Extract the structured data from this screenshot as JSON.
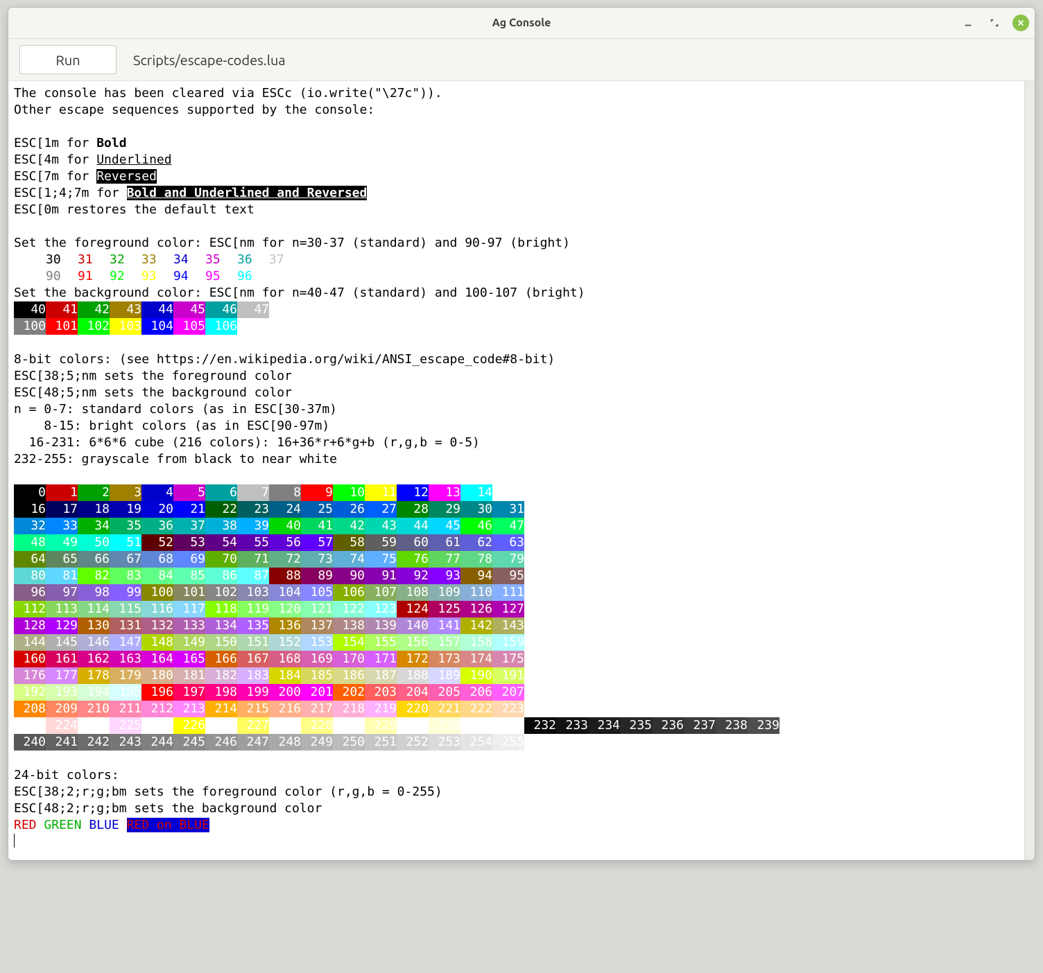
{
  "window": {
    "title": "Ag Console"
  },
  "toolbar": {
    "run_label": "Run",
    "script_path": "Scripts/escape-codes.lua"
  },
  "intro": {
    "l1": "The console has been cleared via ESCc (io.write(\"\\27c\")).",
    "l2": "Other escape sequences supported by the console:",
    "bold_prefix": "ESC[1m for ",
    "bold_word": "Bold",
    "ul_prefix": "ESC[4m for ",
    "ul_word": "Underlined",
    "rev_prefix": "ESC[7m for ",
    "rev_word": "Reversed",
    "combo_prefix": "ESC[1;4;7m for ",
    "combo_word": "Bold and Underlined and Reversed",
    "reset": "ESC[0m restores the default text"
  },
  "fg_header": "Set the foreground color: ESC[nm for n=30-37 (standard) and 90-97 (bright)",
  "bg_header": "Set the background color: ESC[nm for n=40-47 (standard) and 100-107 (bright)",
  "ansi16": {
    "std": [
      "#000000",
      "#cc0000",
      "#00a000",
      "#a08000",
      "#0000cc",
      "#cc00cc",
      "#00a0a0",
      "#c0c0c0"
    ],
    "bri": [
      "#808080",
      "#ff0000",
      "#00ff00",
      "#ffff00",
      "#0000ff",
      "#ff00ff",
      "#00ffff",
      "#ffffff"
    ],
    "fg_std_labels": [
      "30",
      "31",
      "32",
      "33",
      "34",
      "35",
      "36",
      "37"
    ],
    "fg_bri_labels": [
      "90",
      "91",
      "92",
      "93",
      "94",
      "95",
      "96",
      "97"
    ],
    "bg_std_labels": [
      "40",
      "41",
      "42",
      "43",
      "44",
      "45",
      "46",
      "47"
    ],
    "bg_bri_labels": [
      "100",
      "101",
      "102",
      "103",
      "104",
      "105",
      "106",
      "107"
    ]
  },
  "eight_bit": {
    "l1": "8-bit colors: (see https://en.wikipedia.org/wiki/ANSI_escape_code#8-bit)",
    "l2": "ESC[38;5;nm sets the foreground color",
    "l3": "ESC[48;5;nm sets the background color",
    "l4": "n = 0-7: standard colors (as in ESC[30-37m)",
    "l5": "    8-15: bright colors (as in ESC[90-97m)",
    "l6": "  16-231: 6*6*6 cube (216 colors): 16+36*r+6*g+b (r,g,b = 0-5)",
    "l7": "232-255: grayscale from black to near white",
    "cube_levels": [
      0,
      95,
      135,
      175,
      215,
      255
    ]
  },
  "twentyfour": {
    "l1": "24-bit colors:",
    "l2": "ESC[38;2;r;g;bm sets the foreground color (r,g,b = 0-255)",
    "l3": "ESC[48;2;r;g;bm sets the background color",
    "red": "RED",
    "green": "GREEN",
    "blue": "BLUE",
    "redonblue": "RED on BLUE"
  }
}
